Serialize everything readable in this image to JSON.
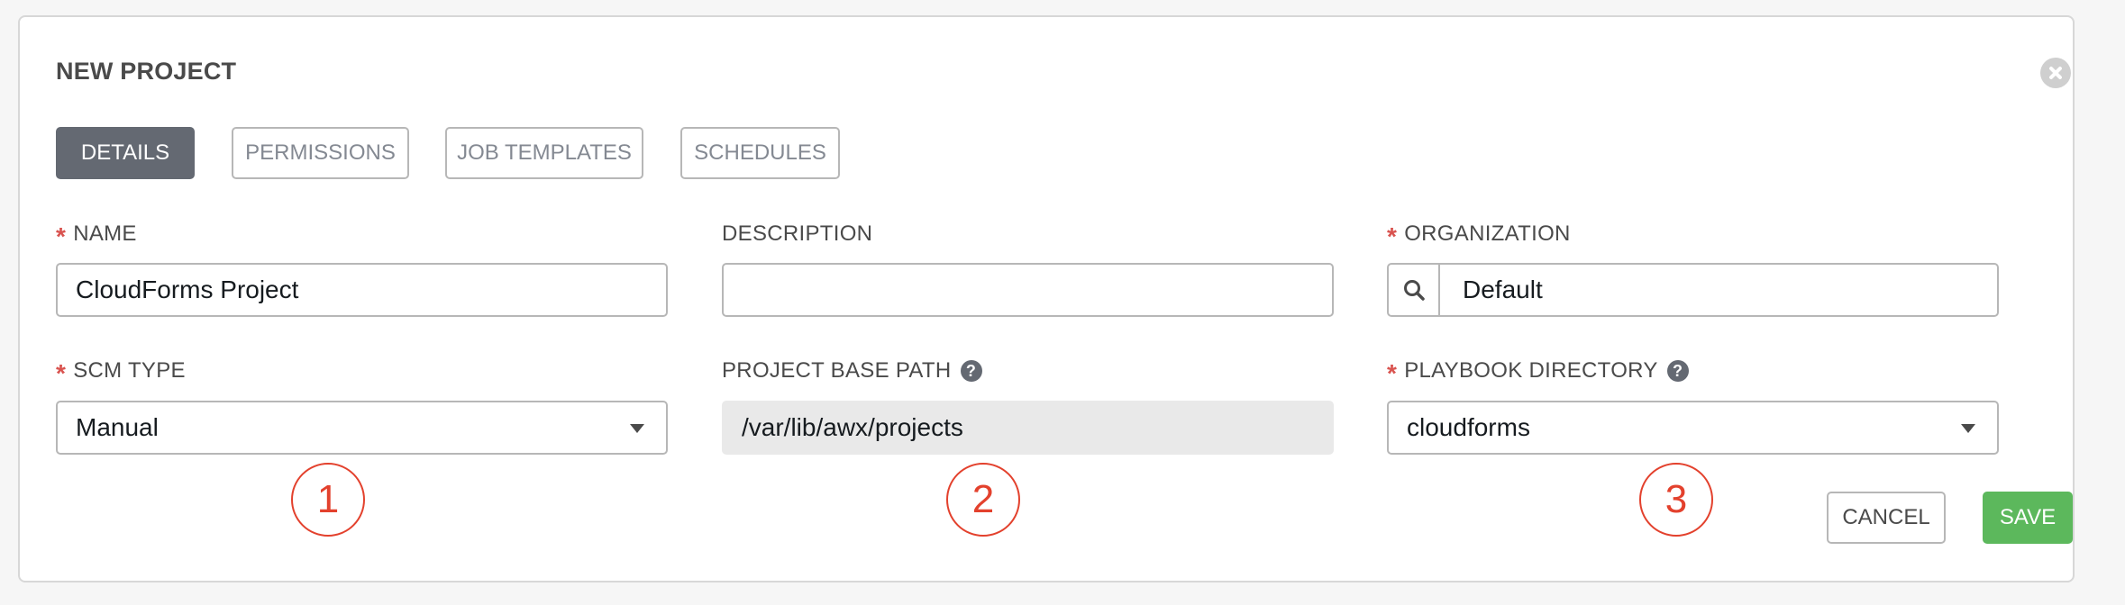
{
  "panel": {
    "title": "NEW PROJECT"
  },
  "tabs": [
    {
      "label": "DETAILS",
      "active": true
    },
    {
      "label": "PERMISSIONS",
      "active": false
    },
    {
      "label": "JOB TEMPLATES",
      "active": false
    },
    {
      "label": "SCHEDULES",
      "active": false
    }
  ],
  "fields": {
    "name": {
      "label": "NAME",
      "required": true,
      "value": "CloudForms Project"
    },
    "description": {
      "label": "DESCRIPTION",
      "required": false,
      "value": ""
    },
    "organization": {
      "label": "ORGANIZATION",
      "required": true,
      "value": "Default"
    },
    "scm_type": {
      "label": "SCM TYPE",
      "required": true,
      "value": "Manual"
    },
    "project_base_path": {
      "label": "PROJECT BASE PATH",
      "value": "/var/lib/awx/projects"
    },
    "playbook_directory": {
      "label": "PLAYBOOK DIRECTORY",
      "required": true,
      "value": "cloudforms"
    }
  },
  "required_marker": "*",
  "help_glyph": "?",
  "annotations": [
    "1",
    "2",
    "3"
  ],
  "buttons": {
    "cancel": "CANCEL",
    "save": "SAVE"
  },
  "colors": {
    "active_tab": "#646972",
    "required": "#d9534f",
    "save": "#5cb85c",
    "annotation": "#e3412d"
  }
}
